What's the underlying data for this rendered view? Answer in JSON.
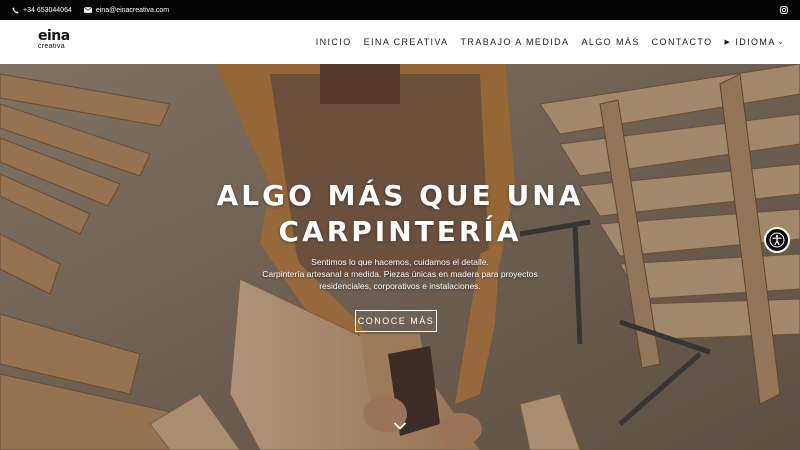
{
  "topbar": {
    "phone": "+34 653044064",
    "email": "eina@einacreativa.com"
  },
  "logo": {
    "line1": "eina",
    "line2": "creativa"
  },
  "nav": {
    "items": [
      "INICIO",
      "EINA CREATIVA",
      "TRABAJO A MEDIDA",
      "ALGO MÁS",
      "CONTACTO"
    ],
    "language": "IDIOMA"
  },
  "hero": {
    "title_line1": "ALGO MÁS QUE UNA",
    "title_line2": "CARPINTERÍA",
    "subtitle_line1": "Sentimos lo que hacemos, cuidamos el detalle.",
    "subtitle_line2": "Carpintería artesanal a medida. Piezas únicas en madera para proyectos",
    "subtitle_line3": "residenciales, corporativos e instalaciones.",
    "cta_label": "CONOCE MÁS"
  },
  "icons": [
    "phone-icon",
    "mail-icon",
    "instagram-icon",
    "chevron-down-icon",
    "accessibility-icon"
  ],
  "colors": {
    "topbar_bg": "#050505",
    "header_bg": "#ffffff",
    "text_light": "#ffffff",
    "apron": "#b8763a"
  }
}
